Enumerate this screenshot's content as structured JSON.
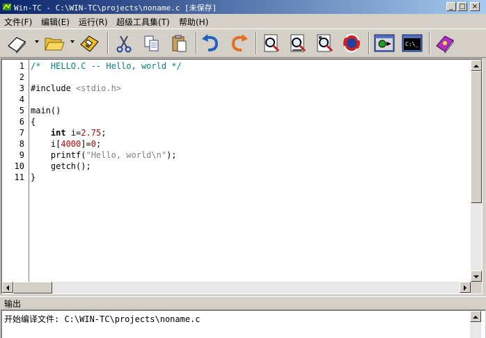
{
  "window": {
    "title": "Win-TC - C:\\WIN-TC\\projects\\noname.c [未保存]",
    "minimize_glyph": "_",
    "maximize_glyph": "□",
    "close_glyph": "×"
  },
  "menu": [
    {
      "label": "文件(F)"
    },
    {
      "label": "编辑(E)"
    },
    {
      "label": "运行(R)"
    },
    {
      "label": "超级工具集(T)"
    },
    {
      "label": "帮助(H)"
    }
  ],
  "toolbar": [
    {
      "icon": "new-file-icon"
    },
    {
      "icon": "open-folder-icon"
    },
    {
      "icon": "save-disk-icon"
    },
    {
      "icon": "cut-scissors-icon"
    },
    {
      "icon": "copy-icon"
    },
    {
      "icon": "paste-icon"
    },
    {
      "icon": "undo-icon"
    },
    {
      "icon": "redo-icon"
    },
    {
      "icon": "find-icon"
    },
    {
      "icon": "find-next-icon"
    },
    {
      "icon": "replace-icon"
    },
    {
      "icon": "refresh-icon"
    },
    {
      "icon": "compile-icon"
    },
    {
      "icon": "run-console-icon"
    },
    {
      "icon": "help-book-icon"
    }
  ],
  "colors": {
    "titlebar_start": "#0a246a",
    "titlebar_end": "#a6caf0",
    "comment": "#008080",
    "number": "#c00000",
    "string": "#808080"
  },
  "editor": {
    "line_numbers": [
      "1",
      "2",
      "3",
      "4",
      "5",
      "6",
      "7",
      "8",
      "9",
      "10",
      "11"
    ],
    "lines": [
      "/*  HELLO.C -- Hello, world */",
      "",
      "#include <stdio.h>",
      "",
      "main()",
      "{",
      "    int i=2.75;",
      "    i[4000]=0;",
      "    printf(\"Hello, world\\n\");",
      "    getch();",
      "}"
    ]
  },
  "output": {
    "label": "输出",
    "text": "开始编译文件: C:\\WIN-TC\\projects\\noname.c"
  }
}
